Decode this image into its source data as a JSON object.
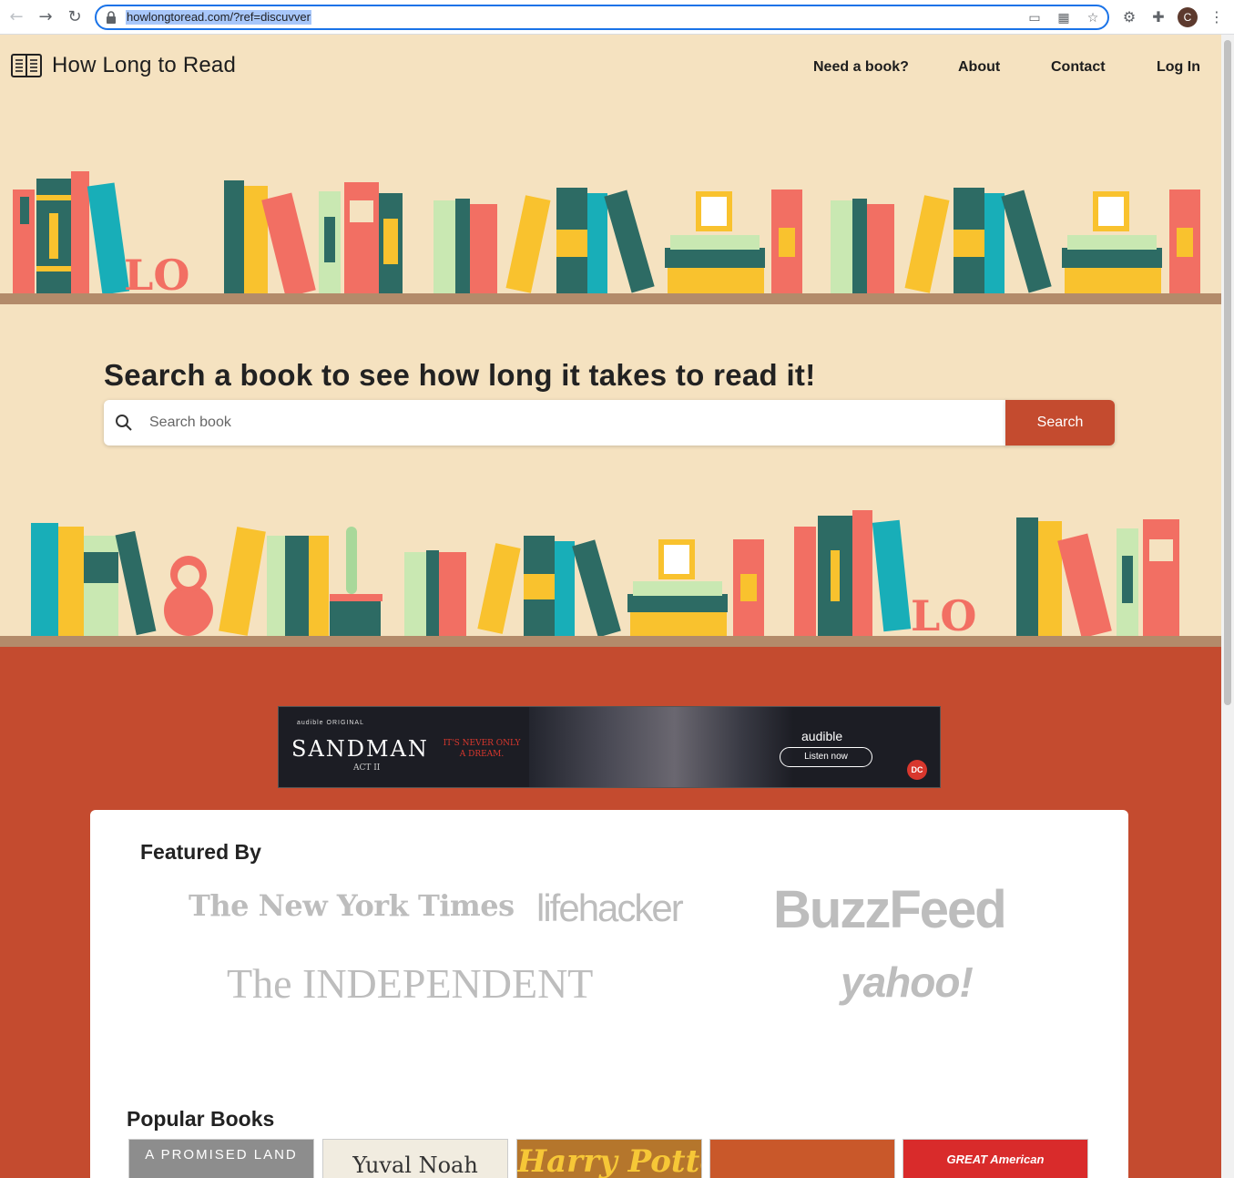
{
  "browser": {
    "url": "howlongtoread.com/?ref=discuvver",
    "profile_initial": "C"
  },
  "site": {
    "brand": "How Long to Read",
    "nav": [
      "Need a book?",
      "About",
      "Contact",
      "Log In"
    ]
  },
  "hero": {
    "headline": "Search a book to see how long it takes to read it!",
    "search_placeholder": "Search book",
    "search_button": "Search"
  },
  "ad": {
    "small_label": "audible ORIGINAL",
    "title": "SANDMAN",
    "subtitle": "ACT II",
    "tagline": "IT'S NEVER ONLY A DREAM.",
    "brand": "audible",
    "cta": "Listen now",
    "badge": "DC"
  },
  "featured": {
    "title": "Featured By",
    "publications": [
      "The New York Times",
      "lifehacker",
      "BuzzFeed",
      "The INDEPENDENT",
      "yahoo!"
    ]
  },
  "popular": {
    "title": "Popular Books",
    "books": [
      {
        "text": "A PROMISED LAND",
        "bg": "#8d8d8d",
        "color": "#ffffff"
      },
      {
        "text": "Yuval Noah",
        "bg": "#f1ece0",
        "color": "#333333"
      },
      {
        "text": "Harry Potter",
        "bg": "#b5762c",
        "color": "#f6c737"
      },
      {
        "text": "",
        "bg": "#c9582a",
        "color": "#ffffff"
      },
      {
        "text": "GREAT American",
        "bg": "#d92b2b",
        "color": "#ffffff"
      }
    ]
  },
  "colors": {
    "background": "#f5e2c0",
    "accent": "#c44b2f",
    "shelf": "#b38b6a"
  }
}
